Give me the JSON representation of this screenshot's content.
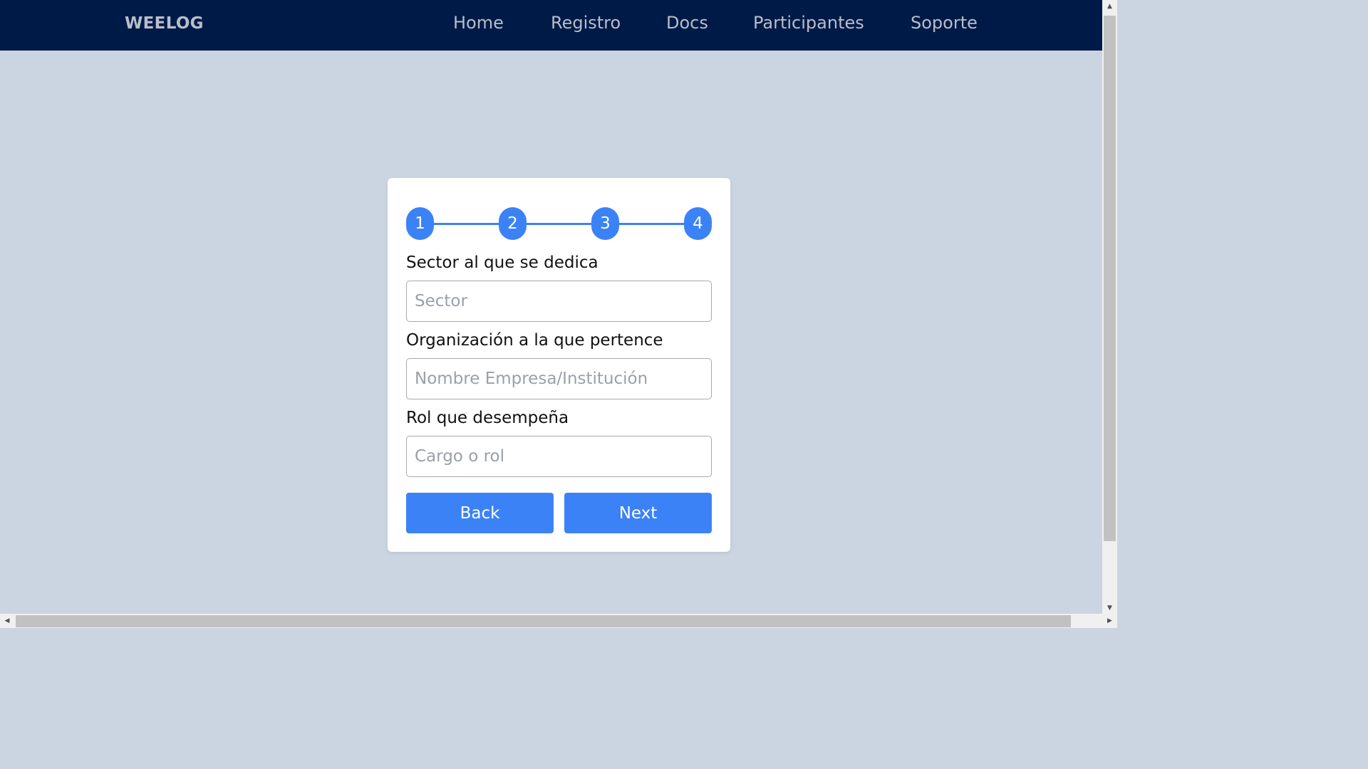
{
  "navbar": {
    "brand": "WEELOG",
    "links": [
      "Home",
      "Registro",
      "Docs",
      "Participantes",
      "Soporte"
    ]
  },
  "stepper": {
    "steps": [
      "1",
      "2",
      "3",
      "4"
    ]
  },
  "form": {
    "sector_label": "Sector al que se dedica",
    "sector_placeholder": "Sector",
    "organization_label": "Organización a la que pertence",
    "organization_placeholder": "Nombre Empresa/Institución",
    "role_label": "Rol que desempeña",
    "role_placeholder": "Cargo o rol",
    "back_label": "Back",
    "next_label": "Next"
  },
  "colors": {
    "navbar_bg": "#001a47",
    "page_bg": "#cbd5e1",
    "accent": "#3b82f6",
    "nav_text": "#b8bec9"
  },
  "icons": {
    "scroll_up": "triangle-up-icon",
    "scroll_down": "triangle-down-icon",
    "scroll_left": "triangle-left-icon",
    "scroll_right": "triangle-right-icon"
  }
}
